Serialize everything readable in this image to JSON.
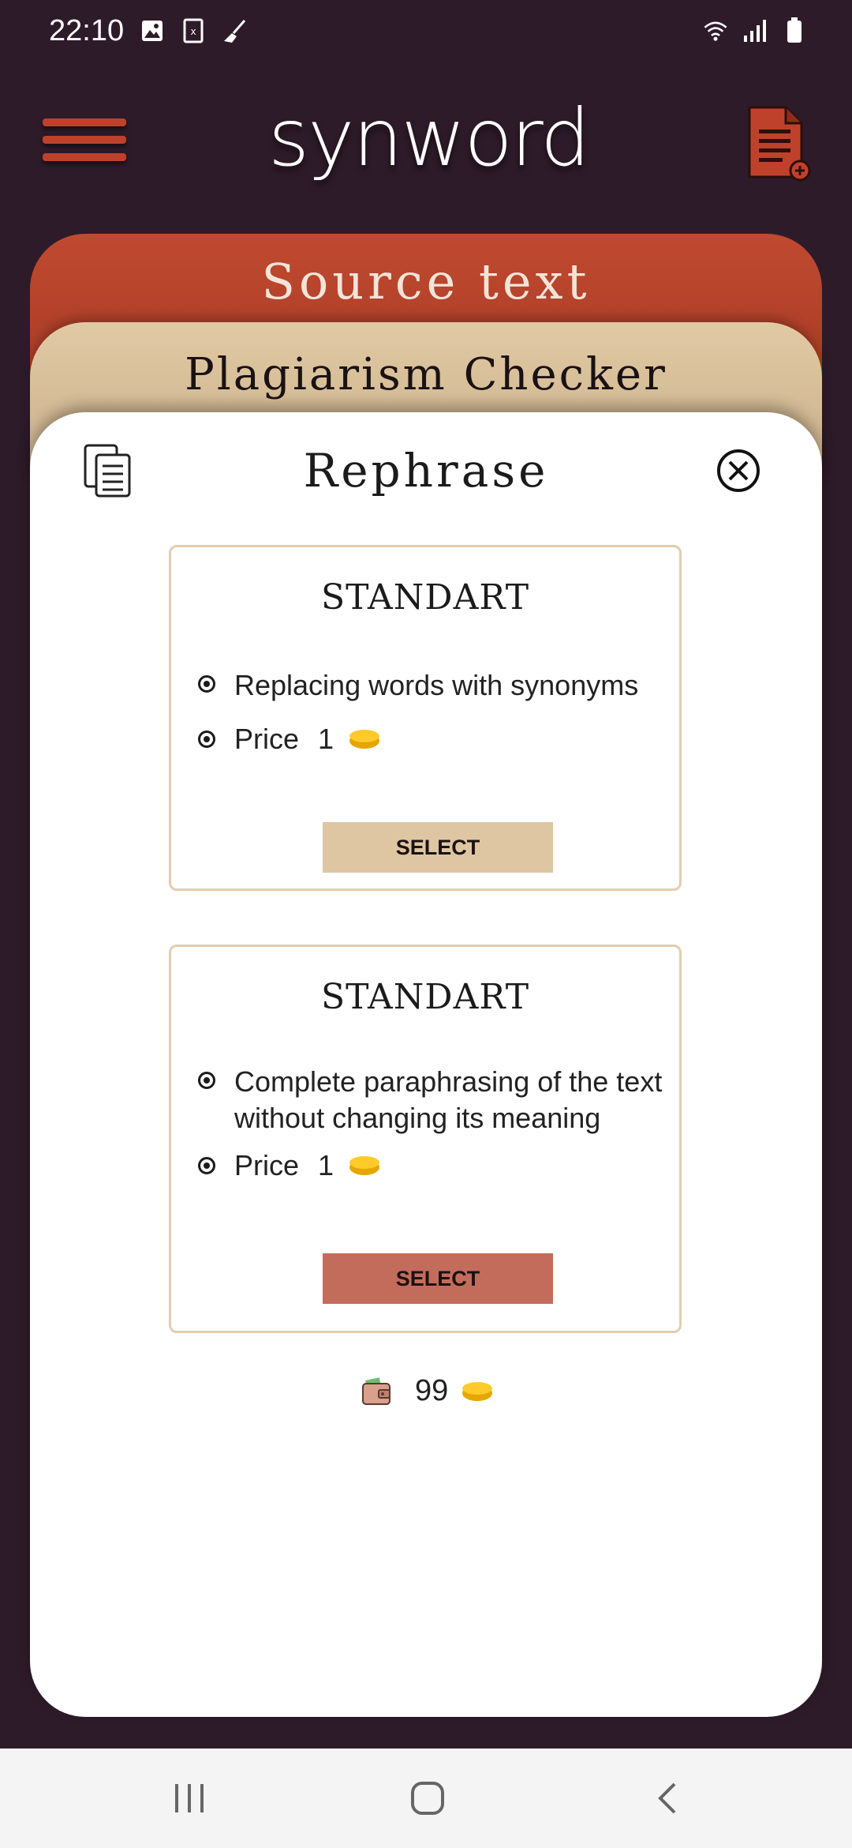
{
  "status_bar": {
    "time": "22:10",
    "left_icons": [
      "image-icon",
      "sim-icon",
      "broom-icon"
    ],
    "right_icons": [
      "wifi-icon",
      "signal-icon",
      "battery-icon"
    ]
  },
  "app_bar": {
    "logo": "synword"
  },
  "tabs": {
    "source_text": "Source text",
    "plagiarism_checker": "Plagiarism Checker"
  },
  "rephrase_sheet": {
    "title": "Rephrase",
    "plans": [
      {
        "title": "STANDART",
        "feature": "Replacing words with synonyms",
        "price_label": "Price",
        "price_value": "1",
        "button": "SELECT",
        "button_color": "#dfc6a2"
      },
      {
        "title": "STANDART",
        "feature_line1": "Complete paraphrasing of the text",
        "feature_line2": "without changing its meaning",
        "price_label": "Price",
        "price_value": "1",
        "button": "SELECT",
        "button_color": "#c46c5b"
      }
    ],
    "balance": "99"
  },
  "colors": {
    "background": "#2e1b29",
    "accent_red": "#c0412b",
    "accent_tan": "#e1c9a4",
    "coin": "#ffcb2b"
  }
}
